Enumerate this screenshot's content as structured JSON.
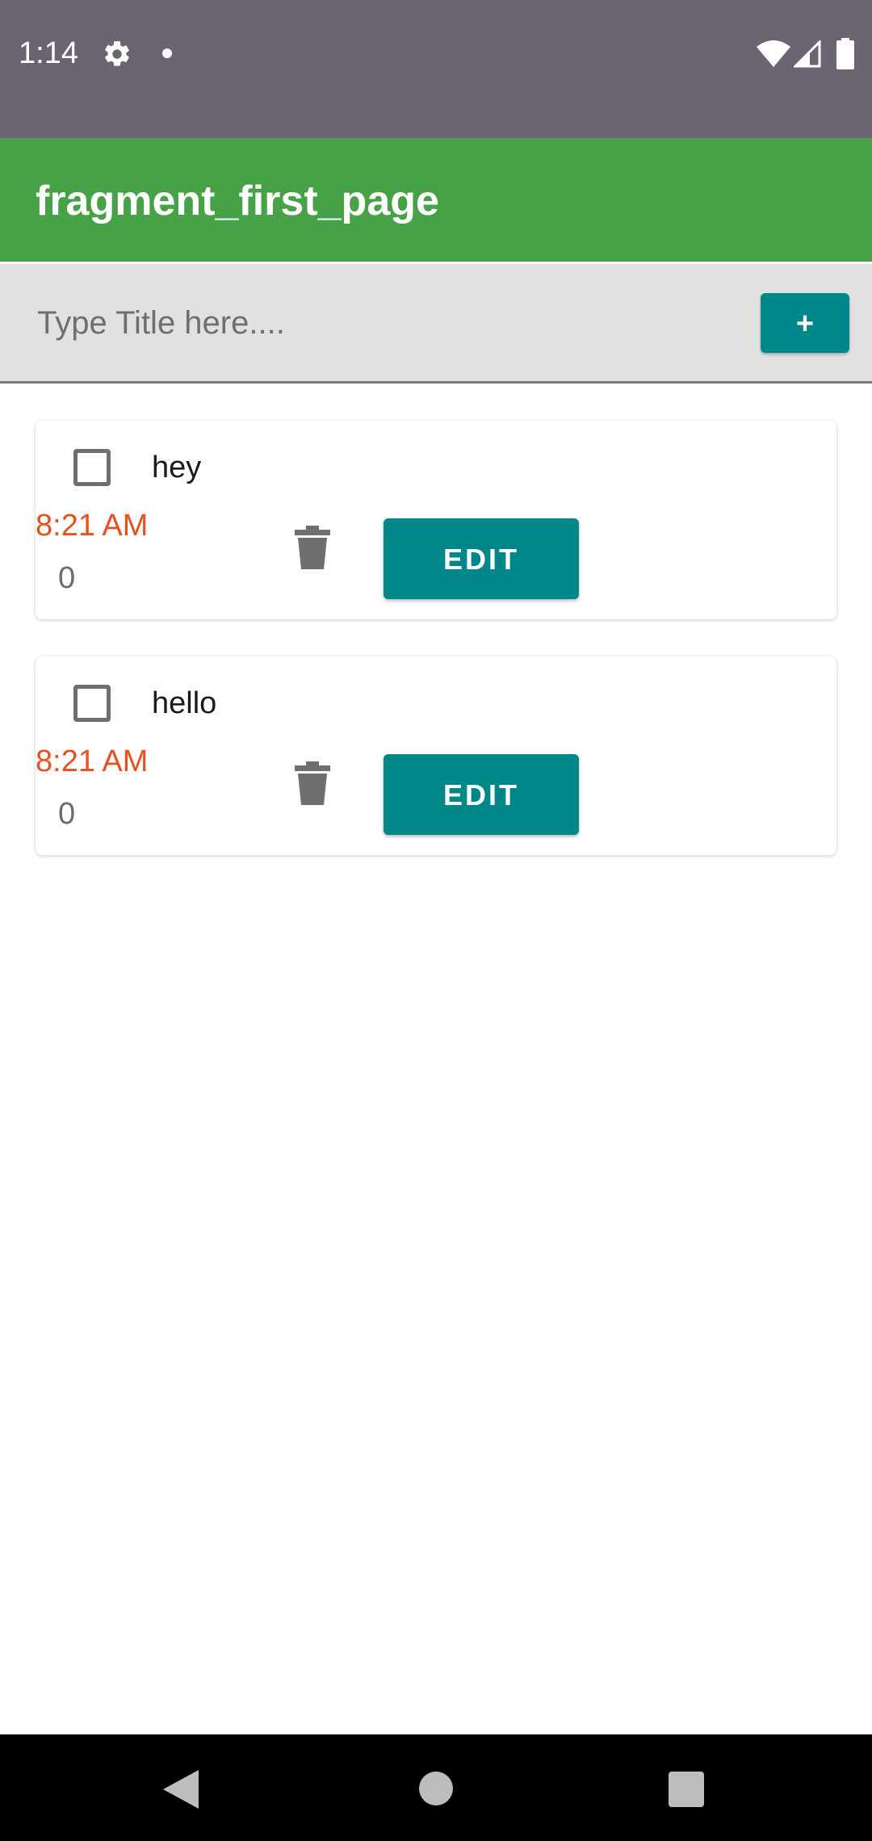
{
  "status_bar": {
    "time": "1:14",
    "icons": [
      "gear-icon",
      "notification-dot-icon",
      "wifi-icon",
      "signal-icon",
      "battery-icon"
    ]
  },
  "app_bar": {
    "title": "fragment_first_page"
  },
  "input": {
    "placeholder": "Type Title here....",
    "value": "",
    "add_label": "+"
  },
  "items": [
    {
      "title": "hey",
      "time": "8:21 AM",
      "count": "0",
      "checked": false,
      "edit_label": "EDIT"
    },
    {
      "title": "hello",
      "time": "8:21 AM",
      "count": "0",
      "checked": false,
      "edit_label": "EDIT"
    }
  ],
  "colors": {
    "status_bar": "#6b6571",
    "app_bar": "#46a147",
    "accent": "#00878a",
    "time_text": "#e8501f"
  },
  "nav_bar": {
    "icons": [
      "back-icon",
      "home-icon",
      "recents-icon"
    ]
  }
}
